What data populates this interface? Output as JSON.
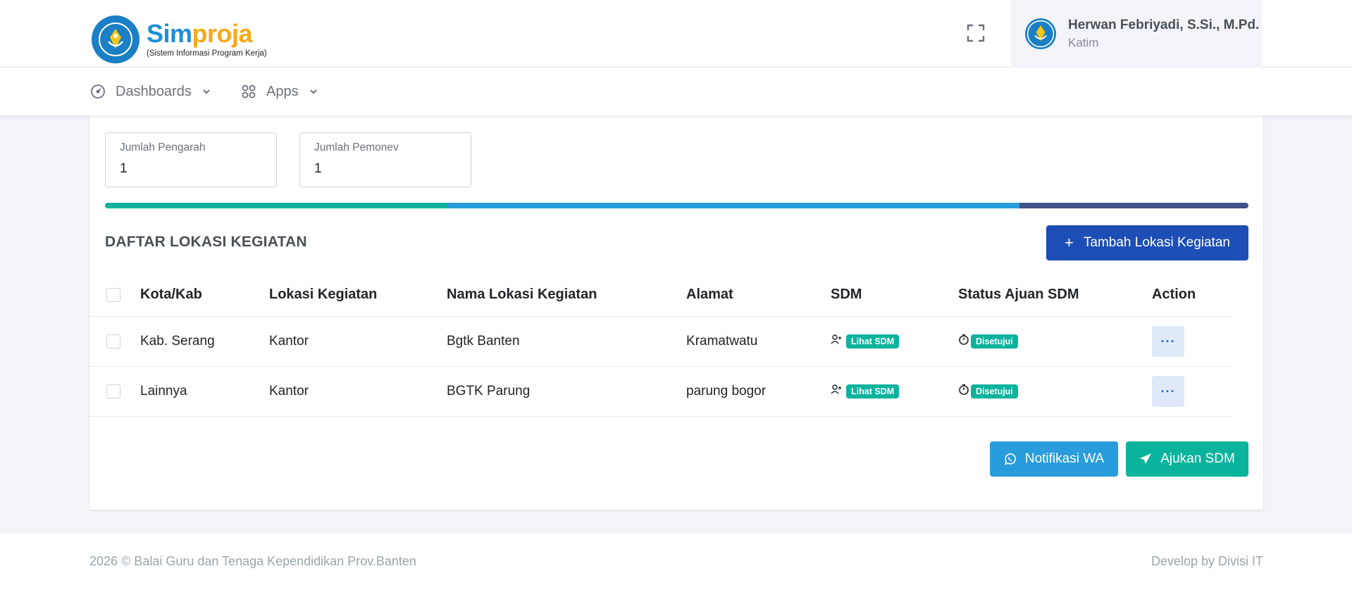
{
  "brand": {
    "title_part1": "Sim",
    "title_part2": "proja",
    "subtitle": "(Sistem Informasi Program Kerja)"
  },
  "user": {
    "name": "Herwan Febriyadi, S.Si., M.Pd.",
    "role": "Katim"
  },
  "nav": {
    "items": [
      {
        "label": "Dashboards",
        "icon": "speedometer-icon"
      },
      {
        "label": "Apps",
        "icon": "apps-grid-icon"
      }
    ]
  },
  "stats": [
    {
      "label": "Jumlah Pengarah",
      "value": "1"
    },
    {
      "label": "Jumlah Pemonev",
      "value": "1"
    }
  ],
  "progress": {
    "segments": [
      {
        "fraction": 0.3,
        "color": "#0ab39c"
      },
      {
        "fraction": 0.5,
        "color": "#299cdb"
      },
      {
        "fraction": 0.2,
        "color": "#405189"
      }
    ]
  },
  "section": {
    "title": "DAFTAR LOKASI KEGIATAN",
    "add_button": "Tambah Lokasi Kegiatan"
  },
  "table": {
    "headers": [
      "Kota/Kab",
      "Lokasi Kegiatan",
      "Nama Lokasi Kegiatan",
      "Alamat",
      "SDM",
      "Status Ajuan SDM",
      "Action"
    ],
    "rows": [
      {
        "kota": "Kab. Serang",
        "lokasi": "Kantor",
        "nama": "Bgtk Banten",
        "alamat": "Kramatwatu",
        "sdm": "Lihat SDM",
        "status": "Disetujui",
        "action": "···"
      },
      {
        "kota": "Lainnya",
        "lokasi": "Kantor",
        "nama": "BGTK Parung",
        "alamat": "parung bogor",
        "sdm": "Lihat SDM",
        "status": "Disetujui",
        "action": "···"
      }
    ]
  },
  "actions": {
    "wa": "Notifikasi WA",
    "sdm": "Ajukan SDM"
  },
  "footer": {
    "left": "2026 © Balai Guru dan Tenaga Kependidikan Prov.Banten",
    "right": "Develop by Divisi IT"
  },
  "colors": {
    "primary": "#1d4eb5",
    "success": "#0ab39c",
    "info": "#299cdb"
  }
}
